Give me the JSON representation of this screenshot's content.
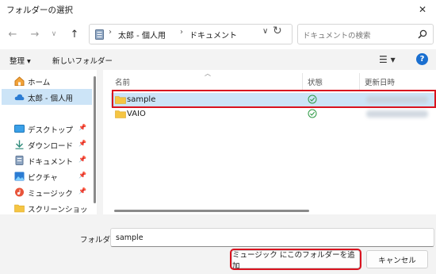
{
  "window": {
    "title": "フォルダーの選択"
  },
  "address": {
    "root": "太郎 - 個人用",
    "current": "ドキュメント"
  },
  "search": {
    "placeholder": "ドキュメントの検索"
  },
  "toolbar": {
    "organize": "整理 ▾",
    "new_folder": "新しいフォルダー",
    "help": "?"
  },
  "sidebar": {
    "items": [
      {
        "label": "ホーム",
        "icon": "home-icon"
      },
      {
        "label": "太郎 - 個人用",
        "icon": "cloud-icon",
        "selected": true
      },
      {
        "label": "デスクトップ",
        "icon": "desktop-icon",
        "pinned": true
      },
      {
        "label": "ダウンロード",
        "icon": "download-icon",
        "pinned": true
      },
      {
        "label": "ドキュメント",
        "icon": "document-icon",
        "pinned": true
      },
      {
        "label": "ピクチャ",
        "icon": "picture-icon",
        "pinned": true
      },
      {
        "label": "ミュージック",
        "icon": "music-icon",
        "pinned": true
      },
      {
        "label": "スクリーンショット",
        "icon": "folder-icon"
      }
    ]
  },
  "columns": {
    "name": "名前",
    "status": "状態",
    "modified": "更新日時"
  },
  "rows": [
    {
      "name": "sample",
      "selected": true
    },
    {
      "name": "VAIO",
      "selected": false
    }
  ],
  "footer": {
    "folder_label": "フォルダー:",
    "folder_value": "sample",
    "add_button": "ミュージック にこのフォルダーを追加",
    "cancel_button": "キャンセル"
  },
  "colors": {
    "accent": "#1a6fd0",
    "highlight": "#d9131f",
    "selection": "#cce4f7"
  }
}
